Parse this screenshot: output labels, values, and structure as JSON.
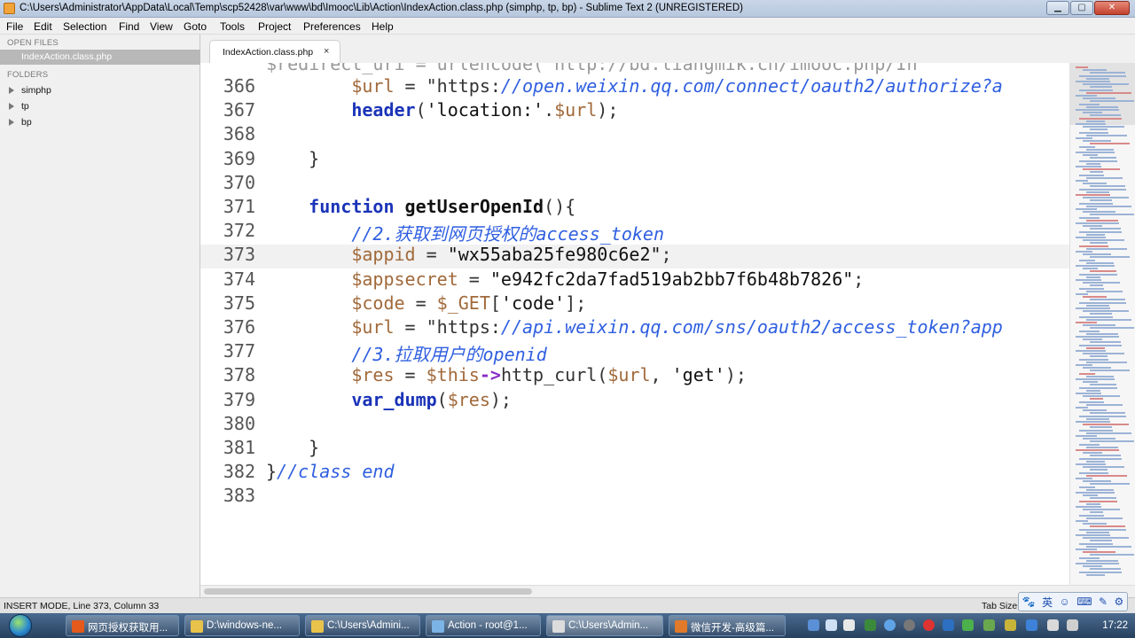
{
  "window": {
    "title": "C:\\Users\\Administrator\\AppData\\Local\\Temp\\scp52428\\var\\www\\bd\\Imooc\\Lib\\Action\\IndexAction.class.php (simphp, tp, bp) - Sublime Text 2 (UNREGISTERED)",
    "controls": [
      "▁",
      "▢",
      "✕"
    ]
  },
  "menu": [
    "File",
    "Edit",
    "Selection",
    "Find",
    "View",
    "Goto",
    "Tools",
    "Project",
    "Preferences",
    "Help"
  ],
  "sidebar": {
    "open_files_header": "OPEN FILES",
    "open_files": [
      "IndexAction.class.php"
    ],
    "folders_header": "FOLDERS",
    "folders": [
      "simphp",
      "tp",
      "bp"
    ]
  },
  "tab": {
    "label": "IndexAction.class.php",
    "close": "×"
  },
  "editor": {
    "partial_line": "$redirect_uri = urlencode('http://bd.liangmik.cn/imooc.php/In",
    "current_line": "373",
    "lines": [
      {
        "n": "366",
        "code": "        $url = \"https://open.weixin.qq.com/connect/oauth2/authorize?a"
      },
      {
        "n": "367",
        "code": "        header('location:'.$url);"
      },
      {
        "n": "368",
        "code": ""
      },
      {
        "n": "369",
        "code": "    }"
      },
      {
        "n": "370",
        "code": ""
      },
      {
        "n": "371",
        "code": "    function getUserOpenId(){"
      },
      {
        "n": "372",
        "code": "        //2.获取到网页授权的access_token"
      },
      {
        "n": "373",
        "code": "        $appid = \"wx55aba25fe980c6e2\";"
      },
      {
        "n": "374",
        "code": "        $appsecret = \"e942fc2da7fad519ab2bb7f6b48b7826\";"
      },
      {
        "n": "375",
        "code": "        $code = $_GET['code'];"
      },
      {
        "n": "376",
        "code": "        $url = \"https://api.weixin.qq.com/sns/oauth2/access_token?app"
      },
      {
        "n": "377",
        "code": "        //3.拉取用户的openid"
      },
      {
        "n": "378",
        "code": "        $res = $this->http_curl($url, 'get');"
      },
      {
        "n": "379",
        "code": "        var_dump($res);"
      },
      {
        "n": "380",
        "code": ""
      },
      {
        "n": "381",
        "code": "    }"
      },
      {
        "n": "382",
        "code": "}//class end"
      },
      {
        "n": "383",
        "code": ""
      }
    ]
  },
  "status": {
    "left": "INSERT MODE, Line 373, Column 33",
    "right": "Tab Size"
  },
  "ime": [
    "🐾",
    "英",
    "☺",
    "⌨",
    "✎",
    "⚙"
  ],
  "taskbar": {
    "items": [
      {
        "label": "网页授权获取用...",
        "icon_color": "#e35a1c"
      },
      {
        "label": "D:\\windows-ne...",
        "icon_color": "#e8c34b"
      },
      {
        "label": "C:\\Users\\Admini...",
        "icon_color": "#e8c34b"
      },
      {
        "label": "Action - root@1...",
        "icon_color": "#7bb3e6"
      },
      {
        "label": "C:\\Users\\Admin...",
        "icon_color": "#dcdcdc"
      },
      {
        "label": "微信开发-高级篇...",
        "icon_color": "#e07a2a"
      }
    ],
    "clock": "17:22"
  }
}
